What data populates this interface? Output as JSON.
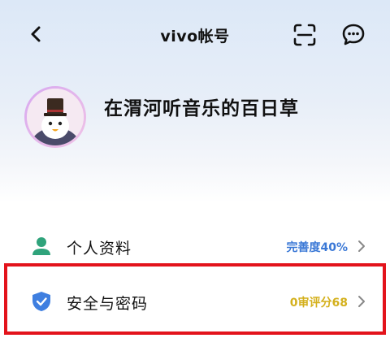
{
  "header": {
    "title": "vivo帐号",
    "back_icon": "chevron-left-icon",
    "scan_icon": "scan-icon",
    "message_icon": "chat-bubble-icon"
  },
  "profile": {
    "nickname": "在渭河听音乐的百日草",
    "avatar_icon": "avatar-top-hat-character"
  },
  "menu": {
    "items": [
      {
        "label": "个人资料",
        "value": "完善度40%",
        "icon": "person-icon",
        "value_color": "#3a78d6"
      },
      {
        "label": "安全与密码",
        "value": "0审评分68",
        "icon": "shield-check-icon",
        "value_color": "#d4b01c"
      }
    ]
  },
  "highlight_color": "#e3131b"
}
